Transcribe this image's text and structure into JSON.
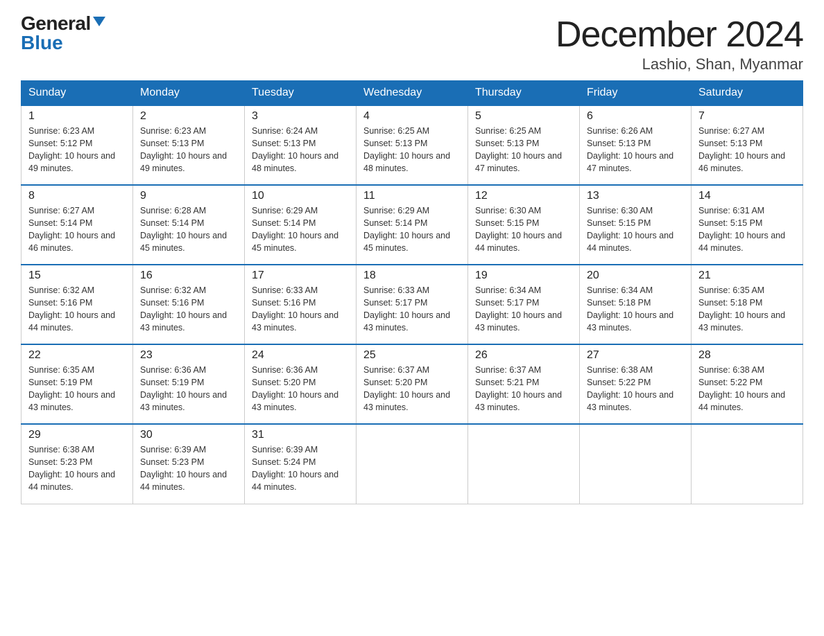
{
  "logo": {
    "general": "General",
    "blue": "Blue"
  },
  "header": {
    "month": "December 2024",
    "location": "Lashio, Shan, Myanmar"
  },
  "weekdays": [
    "Sunday",
    "Monday",
    "Tuesday",
    "Wednesday",
    "Thursday",
    "Friday",
    "Saturday"
  ],
  "weeks": [
    [
      {
        "day": "1",
        "sunrise": "6:23 AM",
        "sunset": "5:12 PM",
        "daylight": "10 hours and 49 minutes."
      },
      {
        "day": "2",
        "sunrise": "6:23 AM",
        "sunset": "5:13 PM",
        "daylight": "10 hours and 49 minutes."
      },
      {
        "day": "3",
        "sunrise": "6:24 AM",
        "sunset": "5:13 PM",
        "daylight": "10 hours and 48 minutes."
      },
      {
        "day": "4",
        "sunrise": "6:25 AM",
        "sunset": "5:13 PM",
        "daylight": "10 hours and 48 minutes."
      },
      {
        "day": "5",
        "sunrise": "6:25 AM",
        "sunset": "5:13 PM",
        "daylight": "10 hours and 47 minutes."
      },
      {
        "day": "6",
        "sunrise": "6:26 AM",
        "sunset": "5:13 PM",
        "daylight": "10 hours and 47 minutes."
      },
      {
        "day": "7",
        "sunrise": "6:27 AM",
        "sunset": "5:13 PM",
        "daylight": "10 hours and 46 minutes."
      }
    ],
    [
      {
        "day": "8",
        "sunrise": "6:27 AM",
        "sunset": "5:14 PM",
        "daylight": "10 hours and 46 minutes."
      },
      {
        "day": "9",
        "sunrise": "6:28 AM",
        "sunset": "5:14 PM",
        "daylight": "10 hours and 45 minutes."
      },
      {
        "day": "10",
        "sunrise": "6:29 AM",
        "sunset": "5:14 PM",
        "daylight": "10 hours and 45 minutes."
      },
      {
        "day": "11",
        "sunrise": "6:29 AM",
        "sunset": "5:14 PM",
        "daylight": "10 hours and 45 minutes."
      },
      {
        "day": "12",
        "sunrise": "6:30 AM",
        "sunset": "5:15 PM",
        "daylight": "10 hours and 44 minutes."
      },
      {
        "day": "13",
        "sunrise": "6:30 AM",
        "sunset": "5:15 PM",
        "daylight": "10 hours and 44 minutes."
      },
      {
        "day": "14",
        "sunrise": "6:31 AM",
        "sunset": "5:15 PM",
        "daylight": "10 hours and 44 minutes."
      }
    ],
    [
      {
        "day": "15",
        "sunrise": "6:32 AM",
        "sunset": "5:16 PM",
        "daylight": "10 hours and 44 minutes."
      },
      {
        "day": "16",
        "sunrise": "6:32 AM",
        "sunset": "5:16 PM",
        "daylight": "10 hours and 43 minutes."
      },
      {
        "day": "17",
        "sunrise": "6:33 AM",
        "sunset": "5:16 PM",
        "daylight": "10 hours and 43 minutes."
      },
      {
        "day": "18",
        "sunrise": "6:33 AM",
        "sunset": "5:17 PM",
        "daylight": "10 hours and 43 minutes."
      },
      {
        "day": "19",
        "sunrise": "6:34 AM",
        "sunset": "5:17 PM",
        "daylight": "10 hours and 43 minutes."
      },
      {
        "day": "20",
        "sunrise": "6:34 AM",
        "sunset": "5:18 PM",
        "daylight": "10 hours and 43 minutes."
      },
      {
        "day": "21",
        "sunrise": "6:35 AM",
        "sunset": "5:18 PM",
        "daylight": "10 hours and 43 minutes."
      }
    ],
    [
      {
        "day": "22",
        "sunrise": "6:35 AM",
        "sunset": "5:19 PM",
        "daylight": "10 hours and 43 minutes."
      },
      {
        "day": "23",
        "sunrise": "6:36 AM",
        "sunset": "5:19 PM",
        "daylight": "10 hours and 43 minutes."
      },
      {
        "day": "24",
        "sunrise": "6:36 AM",
        "sunset": "5:20 PM",
        "daylight": "10 hours and 43 minutes."
      },
      {
        "day": "25",
        "sunrise": "6:37 AM",
        "sunset": "5:20 PM",
        "daylight": "10 hours and 43 minutes."
      },
      {
        "day": "26",
        "sunrise": "6:37 AM",
        "sunset": "5:21 PM",
        "daylight": "10 hours and 43 minutes."
      },
      {
        "day": "27",
        "sunrise": "6:38 AM",
        "sunset": "5:22 PM",
        "daylight": "10 hours and 43 minutes."
      },
      {
        "day": "28",
        "sunrise": "6:38 AM",
        "sunset": "5:22 PM",
        "daylight": "10 hours and 44 minutes."
      }
    ],
    [
      {
        "day": "29",
        "sunrise": "6:38 AM",
        "sunset": "5:23 PM",
        "daylight": "10 hours and 44 minutes."
      },
      {
        "day": "30",
        "sunrise": "6:39 AM",
        "sunset": "5:23 PM",
        "daylight": "10 hours and 44 minutes."
      },
      {
        "day": "31",
        "sunrise": "6:39 AM",
        "sunset": "5:24 PM",
        "daylight": "10 hours and 44 minutes."
      },
      null,
      null,
      null,
      null
    ]
  ]
}
